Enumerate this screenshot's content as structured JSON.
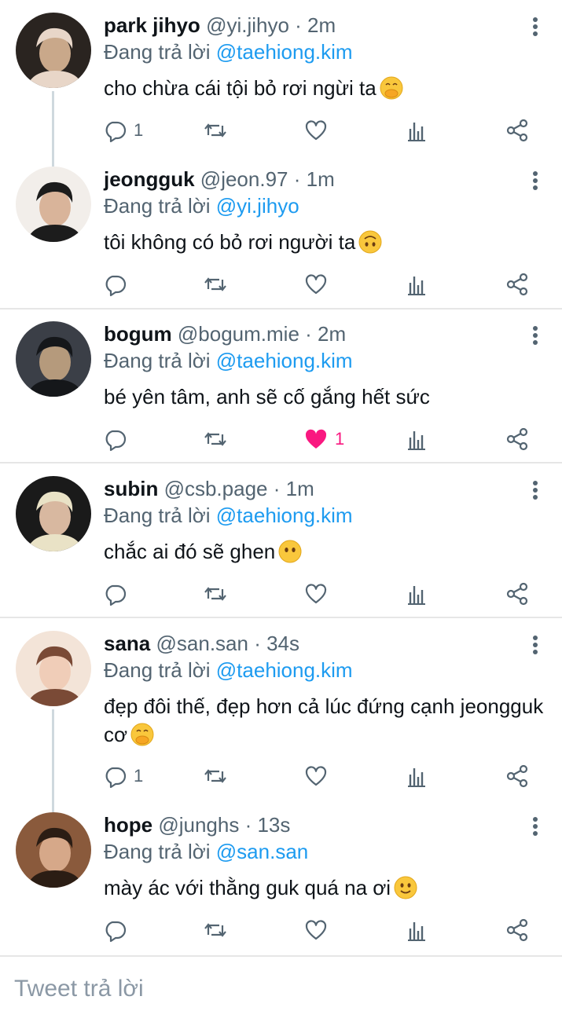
{
  "tweets": [
    {
      "name": "park jihyo",
      "handle": "@yi.jihyo",
      "time": "2m",
      "reply_prefix": "Đang trả lời ",
      "reply_to": "@taehiong.kim",
      "text": "cho chừa cái tội bỏ rơi ngừi ta",
      "emoji": "face-with-hand-over-mouth",
      "reply_count": "1",
      "like_count": "",
      "liked": false,
      "avatar_colors": [
        "#2a2420",
        "#e8d6c8",
        "#c9a88a"
      ]
    },
    {
      "name": "jeongguk",
      "handle": "@jeon.97",
      "time": "1m",
      "reply_prefix": "Đang trả lời ",
      "reply_to": "@yi.jihyo",
      "text": "tôi không có bỏ rơi người ta",
      "emoji": "upside-down-face",
      "reply_count": "",
      "like_count": "",
      "liked": false,
      "avatar_colors": [
        "#f2eeea",
        "#1c1c1c",
        "#d9b49a"
      ]
    },
    {
      "name": "bogum",
      "handle": "@bogum.mie",
      "time": "2m",
      "reply_prefix": "Đang trả lời ",
      "reply_to": "@taehiong.kim",
      "text": "bé yên tâm, anh sẽ cố gắng hết sức",
      "emoji": "",
      "reply_count": "",
      "like_count": "1",
      "liked": true,
      "avatar_colors": [
        "#3b3f47",
        "#15171a",
        "#b59a7c"
      ]
    },
    {
      "name": "subin",
      "handle": "@csb.page",
      "time": "1m",
      "reply_prefix": "Đang trả lời ",
      "reply_to": "@taehiong.kim",
      "text": "chắc ai đó sẽ ghen",
      "emoji": "face-without-mouth",
      "reply_count": "",
      "like_count": "",
      "liked": false,
      "avatar_colors": [
        "#1a1a1a",
        "#e9e2c6",
        "#d8b8a0"
      ]
    },
    {
      "name": "sana",
      "handle": "@san.san",
      "time": "34s",
      "reply_prefix": "Đang trả lời ",
      "reply_to": "@taehiong.kim",
      "text": "đẹp đôi thế, đẹp hơn cả lúc đứng cạnh jeongguk cơ",
      "emoji": "face-with-hand-over-mouth",
      "reply_count": "1",
      "like_count": "",
      "liked": false,
      "avatar_colors": [
        "#f3e4d8",
        "#7a4a36",
        "#f0cdb8"
      ]
    },
    {
      "name": "hope",
      "handle": "@junghs",
      "time": "13s",
      "reply_prefix": "Đang trả lời ",
      "reply_to": "@san.san",
      "text": "mày ác với thằng guk quá na ơi",
      "emoji": "slightly-smiling-face",
      "reply_count": "",
      "like_count": "",
      "liked": false,
      "avatar_colors": [
        "#8a5a3c",
        "#2b1d14",
        "#d6a889"
      ]
    }
  ],
  "composer": {
    "placeholder": "Tweet trả lời"
  },
  "colors": {
    "accent": "#1d9bf0",
    "like": "#f91880",
    "muted": "#536471"
  }
}
